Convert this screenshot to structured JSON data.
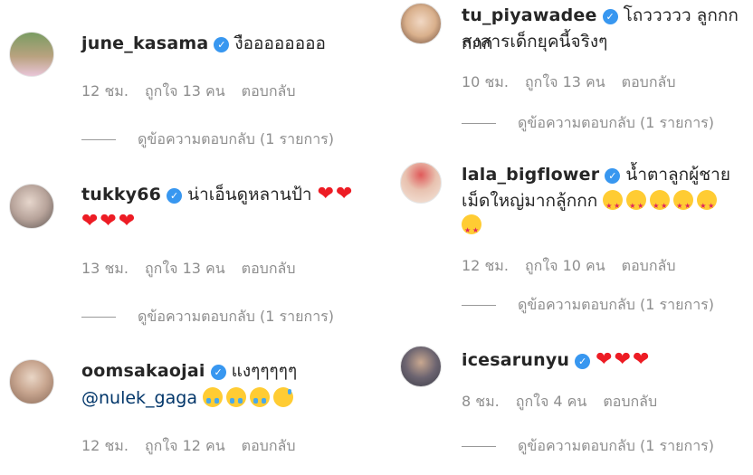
{
  "left": [
    {
      "username": "june_kasama",
      "text": "งืออออออออ",
      "time": "12 ชม.",
      "likes": "ถูกใจ 13 คน",
      "reply": "ตอบกลับ",
      "view_replies": "ดูข้อความตอบกลับ (1 รายการ)",
      "avatar_color": "#6b8c5a"
    },
    {
      "username": "tukky66",
      "text": "น่าเอ็นดูหลานป้า",
      "time": "13 ชม.",
      "likes": "ถูกใจ 13 คน",
      "reply": "ตอบกลับ",
      "view_replies": "ดูข้อความตอบกลับ (1 รายการ)",
      "avatar_color": "#c9b9b0"
    },
    {
      "username": "oomsakaojai",
      "text": "แงๆๆๆๆๆ",
      "mention": "@nulek_gaga",
      "time": "12 ชม.",
      "likes": "ถูกใจ 12 คน",
      "reply": "ตอบกลับ",
      "avatar_color": "#d8c2b0"
    }
  ],
  "right": [
    {
      "username": "tu_piyawadee",
      "text": "โถววววว ลูกกกกกก",
      "text2": "สงสารเด็กยุคนี้จริงๆ",
      "time": "10 ชม.",
      "likes": "ถูกใจ 13 คน",
      "reply": "ตอบกลับ",
      "view_replies": "ดูข้อความตอบกลับ (1 รายการ)",
      "avatar_color": "#d9b08c"
    },
    {
      "username": "lala_bigflower",
      "text": "น้ำตาลูกผู้ชาย",
      "text2": "เม็ดใหญ่มากลู้กกก",
      "time": "12 ชม.",
      "likes": "ถูกใจ 10 คน",
      "reply": "ตอบกลับ",
      "view_replies": "ดูข้อความตอบกลับ (1 รายการ)",
      "avatar_color": "#e05a5a"
    },
    {
      "username": "icesarunyu",
      "time": "8 ชม.",
      "likes": "ถูกใจ 4 คน",
      "reply": "ตอบกลับ",
      "view_replies": "ดูข้อความตอบกลับ (1 รายการ)",
      "avatar_color": "#4a4a52"
    }
  ],
  "icons": {
    "verified": "verified-badge-icon",
    "heart": "red-heart-emoji",
    "cry": "loudly-crying-face-emoji",
    "star_eyes": "star-struck-emoji",
    "sweat": "grinning-sweat-emoji"
  },
  "colors": {
    "username": "#262626",
    "meta": "#8e8e8e",
    "verified": "#3897f0",
    "mention": "#003569",
    "heart": "#ed1c24"
  }
}
